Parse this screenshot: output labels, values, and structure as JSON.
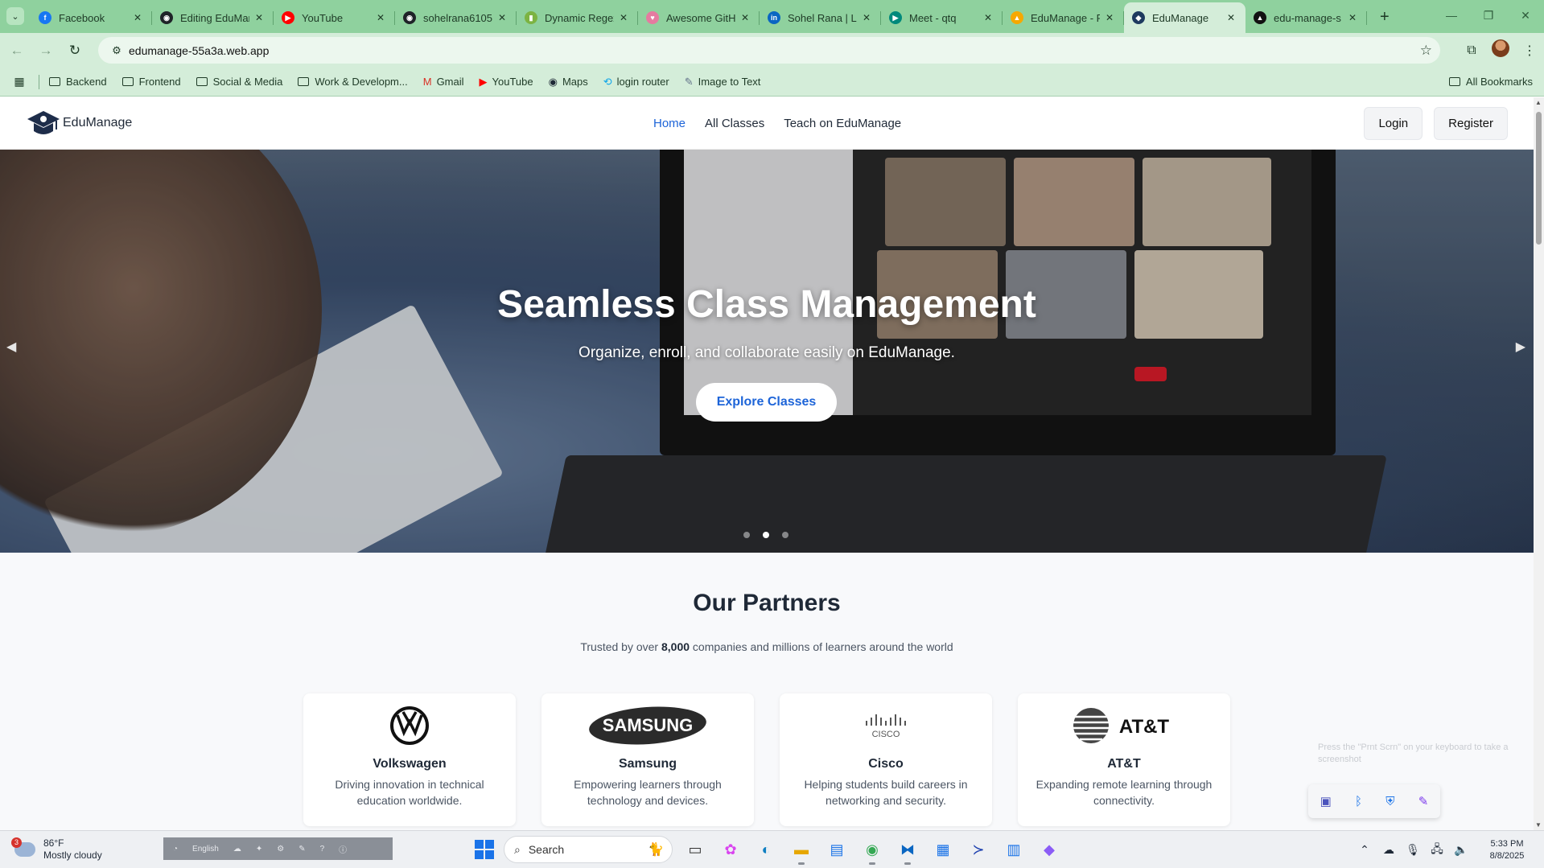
{
  "browser": {
    "tabs": [
      {
        "label": "Facebook",
        "icon": "facebook-icon",
        "color": "#1877f2",
        "glyph": "f"
      },
      {
        "label": "Editing EduManage",
        "icon": "github-icon",
        "color": "#1f2328",
        "glyph": "◉"
      },
      {
        "label": "YouTube",
        "icon": "youtube-icon",
        "color": "#ff0000",
        "glyph": "▶"
      },
      {
        "label": "sohelrana6105",
        "icon": "github-icon",
        "color": "#1f2328",
        "glyph": "◉"
      },
      {
        "label": "Dynamic Regex",
        "icon": "page-icon",
        "color": "#7cb342",
        "glyph": "▮"
      },
      {
        "label": "Awesome GitHub",
        "icon": "heart-icon",
        "color": "#e57ba0",
        "glyph": "♥"
      },
      {
        "label": "Sohel Rana | LinkedIn",
        "icon": "linkedin-icon",
        "color": "#0a66c2",
        "glyph": "in"
      },
      {
        "label": "Meet - qtq",
        "icon": "meet-icon",
        "color": "#00897b",
        "glyph": "▶"
      },
      {
        "label": "EduManage - F",
        "icon": "firebase-icon",
        "color": "#f6a800",
        "glyph": "▲"
      },
      {
        "label": "EduManage",
        "icon": "edumanage-icon",
        "color": "#1e3a5f",
        "glyph": "◆"
      },
      {
        "label": "edu-manage-s",
        "icon": "vercel-icon",
        "color": "#111111",
        "glyph": "▲"
      }
    ],
    "active_tab_index": 9,
    "new_tab": "+",
    "url": "edumanage-55a3a.web.app",
    "bookmarks": [
      {
        "label": "Backend",
        "type": "folder"
      },
      {
        "label": "Frontend",
        "type": "folder"
      },
      {
        "label": "Social & Media",
        "type": "folder"
      },
      {
        "label": "Work & Developm...",
        "type": "folder"
      },
      {
        "label": "Gmail",
        "type": "link",
        "icon": "gmail-icon",
        "glyph": "M",
        "color": "#d93025"
      },
      {
        "label": "YouTube",
        "type": "link",
        "icon": "youtube-icon",
        "glyph": "▶",
        "color": "#ff0000"
      },
      {
        "label": "Maps",
        "type": "link",
        "icon": "maps-icon",
        "glyph": "◉",
        "color": "#1f2937"
      },
      {
        "label": "login router",
        "type": "link",
        "icon": "router-icon",
        "glyph": "⟲",
        "color": "#0ea5e9"
      },
      {
        "label": "Image to Text",
        "type": "link",
        "icon": "image-text-icon",
        "glyph": "✎",
        "color": "#64748b"
      }
    ],
    "all_bookmarks": "All Bookmarks"
  },
  "site": {
    "brand": "EduManage",
    "nav": [
      {
        "label": "Home",
        "active": true
      },
      {
        "label": "All Classes",
        "active": false
      },
      {
        "label": "Teach on EduManage",
        "active": false
      }
    ],
    "login": "Login",
    "register": "Register",
    "hero": {
      "title": "Seamless Class Management",
      "subtitle": "Organize, enroll, and collaborate easily on EduManage.",
      "cta": "Explore Classes",
      "slides": 3,
      "active_slide": 2
    },
    "partners": {
      "title": "Our Partners",
      "subtitle_pre": "Trusted by over ",
      "subtitle_count": "8,000",
      "subtitle_post": " companies and millions of learners around the world",
      "items": [
        {
          "name": "Volkswagen",
          "desc": "Driving innovation in technical education worldwide.",
          "logo": "volkswagen-logo"
        },
        {
          "name": "Samsung",
          "desc": "Empowering learners through technology and devices.",
          "logo": "samsung-logo",
          "logo_text": "SAMSUNG"
        },
        {
          "name": "Cisco",
          "desc": "Helping students build careers in networking and security.",
          "logo": "cisco-logo",
          "logo_text": "CISCO"
        },
        {
          "name": "AT&T",
          "desc": "Expanding remote learning through connectivity.",
          "logo": "att-logo",
          "logo_text": "AT&T"
        }
      ]
    }
  },
  "overlay": {
    "hint": "Press the \"Prnt Scrn\" on your keyboard to take a screenshot"
  },
  "taskbar": {
    "weather_temp": "86°F",
    "weather_desc": "Mostly cloudy",
    "weather_badge": "3",
    "lang": "English",
    "search_placeholder": "Search",
    "time": "5:33 PM",
    "date": "8/8/2025"
  }
}
